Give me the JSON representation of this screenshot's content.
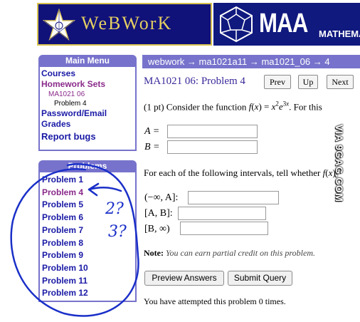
{
  "banner": {
    "webwork_logo_text": "WeBWorK",
    "maa_logo_text": "MAA",
    "maa_logo_subtext": "MATHEMA",
    "colors": {
      "navy": "#11117a",
      "gold": "#e4cf61"
    }
  },
  "main_menu": {
    "title": "Main Menu",
    "items": [
      {
        "label": "Courses"
      },
      {
        "label": "Homework Sets"
      },
      {
        "label": "MA1021 06"
      },
      {
        "label": "Problem 4"
      },
      {
        "label": "Password/Email"
      },
      {
        "label": "Grades"
      },
      {
        "label": "Report bugs"
      }
    ]
  },
  "problems": {
    "title": "Problems",
    "items": [
      "Problem 1",
      "Problem 4",
      "Problem 5",
      "Problem 6",
      "Problem 7",
      "Problem 8",
      "Problem 9",
      "Problem 10",
      "Problem 11",
      "Problem 12"
    ]
  },
  "breadcrumb": "webwork → ma1021a11 → ma1021_06 → 4",
  "page_title": "MA1021 06: Problem 4",
  "nav": {
    "prev": "Prev",
    "up": "Up",
    "next": "Next"
  },
  "problem": {
    "points": "(1 pt)",
    "text": "Consider the function",
    "text_end": ". For this",
    "label_a": "A =",
    "label_b": "B =",
    "intervals_text": "For each of the following intervals, tell whether",
    "intervals": [
      "(−∞, A]:",
      "[A, B]:",
      "[B, ∞)"
    ],
    "note_label": "Note:",
    "note_text": "You can earn partial credit on this problem."
  },
  "buttons": {
    "preview": "Preview Answers",
    "submit": "Submit Query"
  },
  "attempts_text": "You have attempted this problem 0 times.",
  "watermark": "VIA 9GAG.COM",
  "annotation": {
    "ink_color": "#1a2fc8",
    "question_marks": [
      "2?",
      "3?"
    ]
  }
}
